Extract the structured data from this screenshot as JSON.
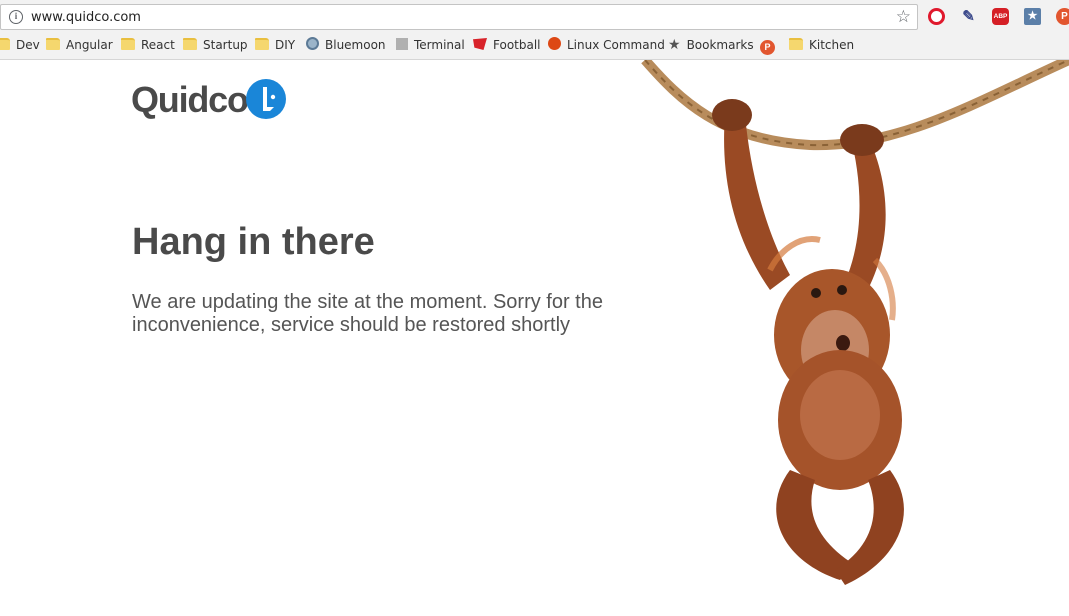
{
  "browser": {
    "url": "www.quidco.com",
    "icons": {
      "info": "info-icon",
      "star": "bookmark-star-icon"
    },
    "extensions": [
      {
        "name": "opera-icon",
        "label": ""
      },
      {
        "name": "eyedropper-icon",
        "label": ""
      },
      {
        "name": "adblock-icon",
        "label": "ABP"
      },
      {
        "name": "bookmark-manager-icon",
        "label": "★"
      },
      {
        "name": "pinterest-icon",
        "label": "P"
      }
    ]
  },
  "bookmarks": [
    {
      "label": "Dev",
      "icon": "folder-icon"
    },
    {
      "label": "Angular",
      "icon": "folder-icon"
    },
    {
      "label": "React",
      "icon": "folder-icon"
    },
    {
      "label": "Startup",
      "icon": "folder-icon"
    },
    {
      "label": "DIY",
      "icon": "folder-icon"
    },
    {
      "label": "Bluemoon",
      "icon": "globe-icon"
    },
    {
      "label": "Terminal",
      "icon": "terminal-icon"
    },
    {
      "label": "Football",
      "icon": "football-icon"
    },
    {
      "label": "Linux Command",
      "icon": "ubuntu-icon"
    },
    {
      "label": "Bookmarks",
      "icon": "star-icon"
    },
    {
      "label": "",
      "icon": "pinterest-icon"
    },
    {
      "label": "Kitchen",
      "icon": "folder-icon"
    }
  ],
  "page": {
    "logo_text": "Quidco",
    "headline": "Hang in there",
    "message": "We are updating the site at the moment. Sorry for the inconvenience, service should be restored shortly"
  },
  "colors": {
    "brand_blue": "#1a86d8",
    "heading_gray": "#4a4a4a"
  }
}
